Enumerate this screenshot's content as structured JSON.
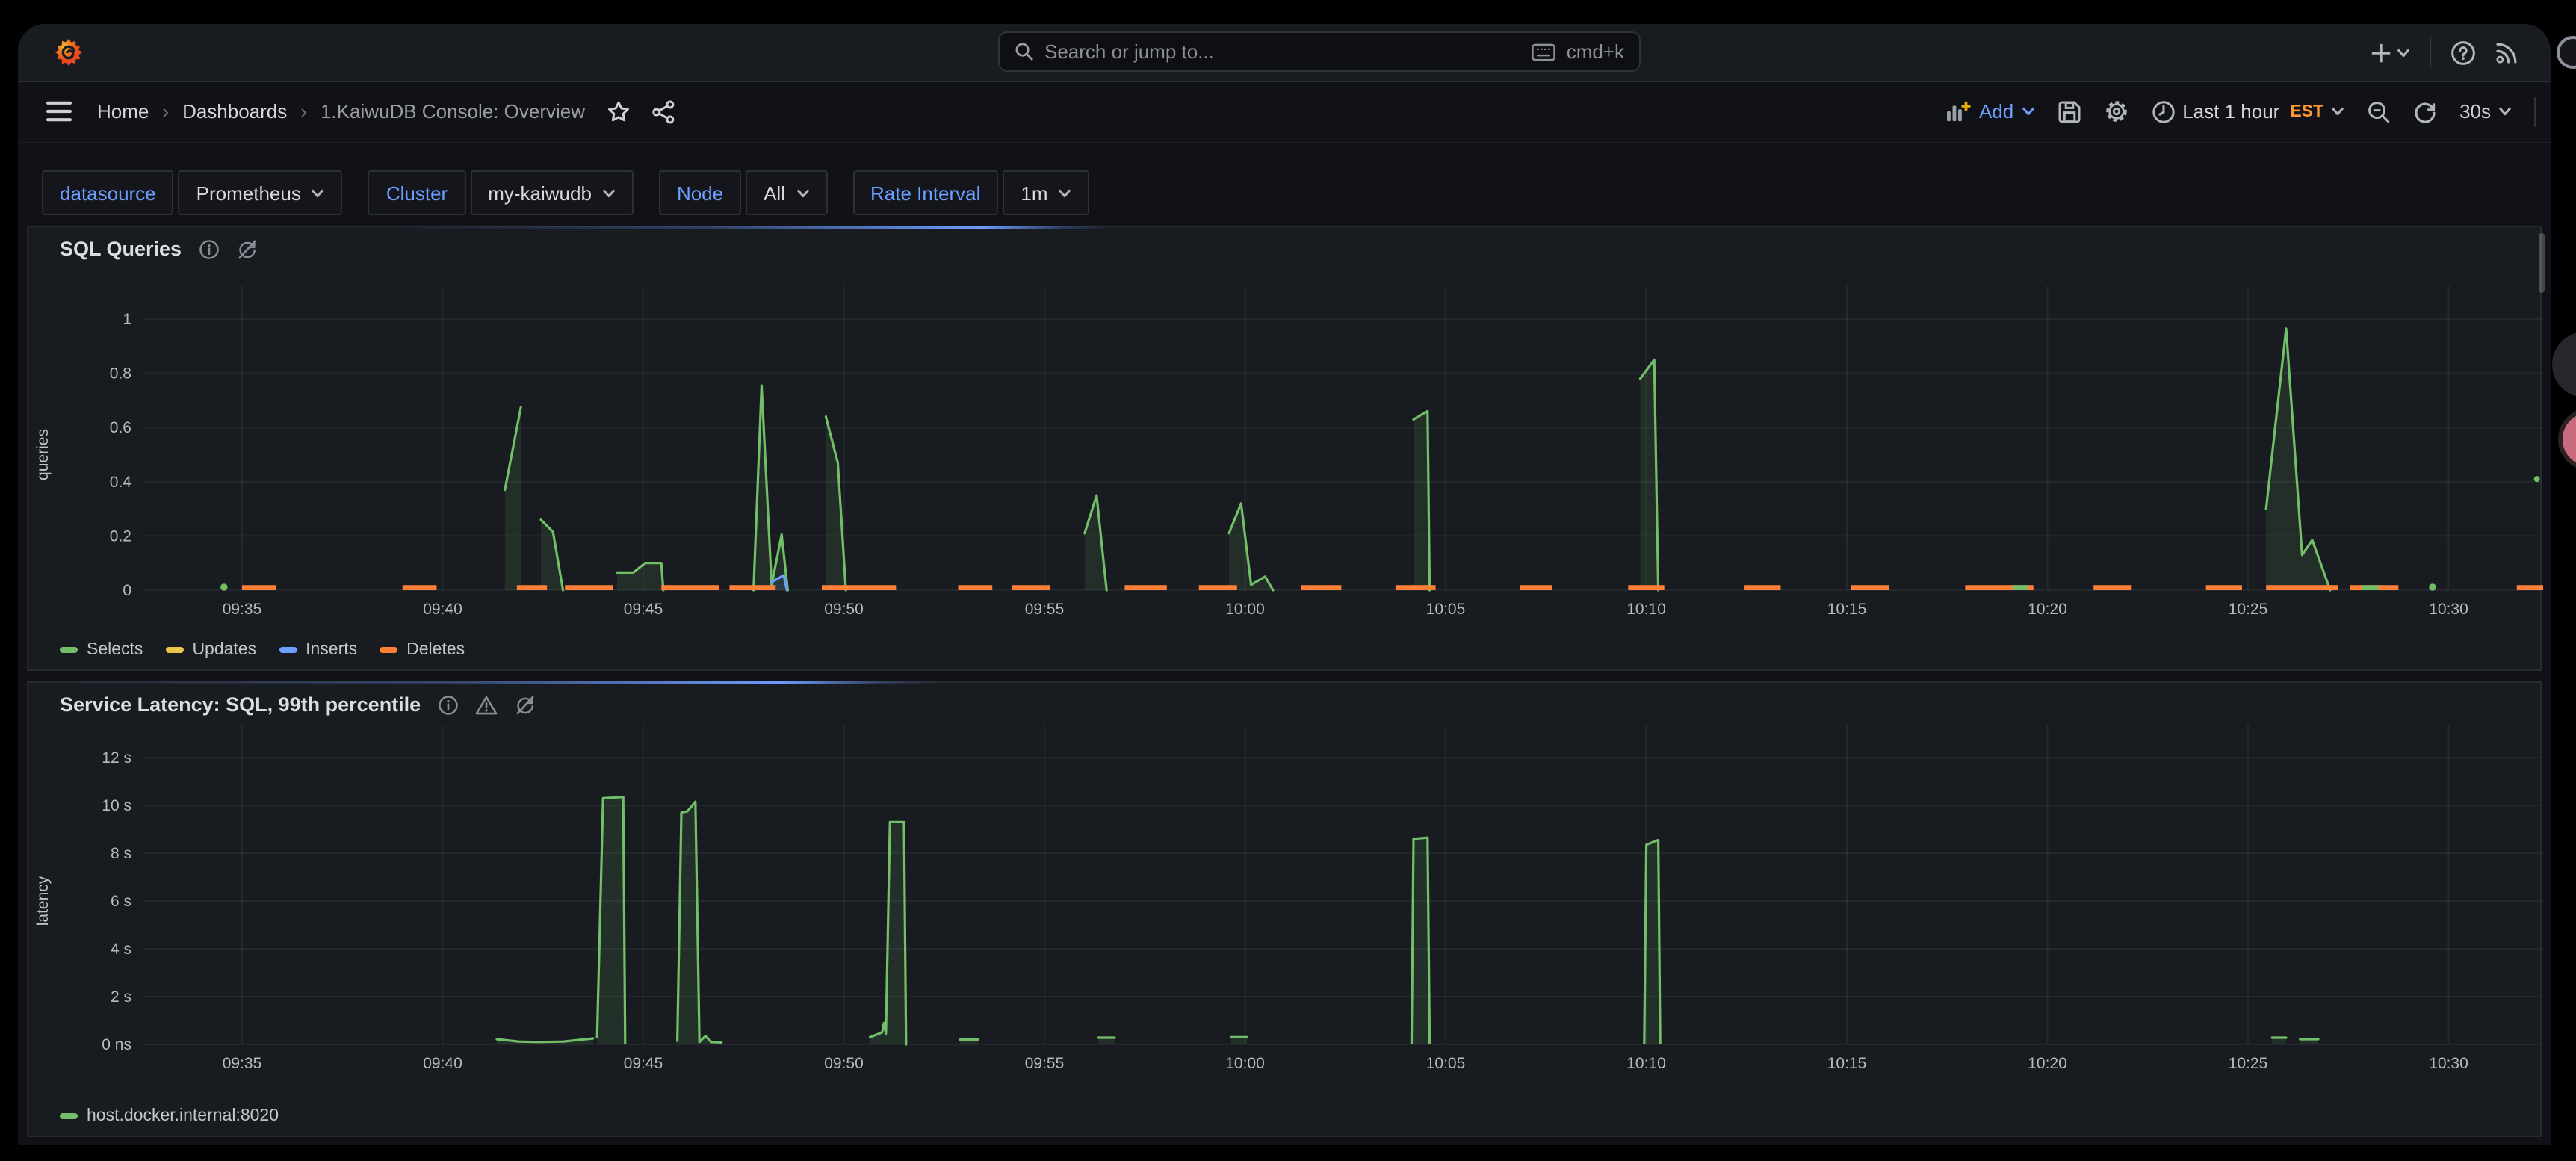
{
  "topbar": {
    "search": {
      "placeholder": "Search or jump to...",
      "shortcut": "cmd+k"
    }
  },
  "breadcrumb": {
    "items": [
      "Home",
      "Dashboards",
      "1.KaiwuDB Console: Overview"
    ]
  },
  "actions": {
    "add_label": "Add",
    "time_range": "Last 1 hour",
    "timezone": "EST",
    "refresh_interval": "30s"
  },
  "variables": [
    {
      "label": "datasource",
      "value": "Prometheus"
    },
    {
      "label": "Cluster",
      "value": "my-kaiwudb"
    },
    {
      "label": "Node",
      "value": "All"
    },
    {
      "label": "Rate Interval",
      "value": "1m"
    }
  ],
  "colors": {
    "accent_blue": "#6e9fff",
    "timezone_orange": "#ff9830",
    "series_green": "#73bf69",
    "series_yellow": "#e7c64a",
    "series_blue": "#6e9fff",
    "series_orange": "#ff8036",
    "panel_bg": "#181b1f",
    "page_bg": "#111217"
  },
  "icons": {
    "logo": "grafana-flame",
    "search": "magnifier",
    "shortcut": "keyboard",
    "new": "plus-chevron",
    "help": "question-circle",
    "news": "rss",
    "menu": "hamburger",
    "favorite": "star-outline",
    "share": "share-nodes",
    "add_panel": "chart-plus",
    "save": "floppy",
    "settings": "gear",
    "time": "clock",
    "zoom_out": "magnifier-minus",
    "refresh": "sync-arrows",
    "panel_info": "info-circle",
    "panel_warning": "warning-triangle",
    "panel_no_refresh": "sync-slash"
  },
  "chart_data": [
    {
      "type": "line",
      "title": "SQL Queries",
      "ylabel": "queries",
      "ylim": [
        0,
        1
      ],
      "grid": true,
      "legend_position": "bottom",
      "y_tick_values": [
        0,
        0.2,
        0.4,
        0.6,
        0.8,
        1
      ],
      "y_tick_labels": [
        "0",
        "0.2",
        "0.4",
        "0.6",
        "0.8",
        "1"
      ],
      "x_tick_minutes": [
        0,
        5,
        10,
        15,
        20,
        25,
        30,
        35,
        40,
        45,
        50,
        55
      ],
      "x_tick_labels": [
        "09:35",
        "09:40",
        "09:45",
        "09:50",
        "09:55",
        "10:00",
        "10:05",
        "10:10",
        "10:15",
        "10:20",
        "10:25",
        "10:30"
      ],
      "x_axis_start": "09:35",
      "series": [
        {
          "name": "Selects",
          "color": "#73bf69",
          "fill": "rgba(115,191,105,0.12)",
          "segments": [
            [
              [
                6.55,
                0.37
              ],
              [
                6.95,
                0.675
              ]
            ],
            [
              [
                7.45,
                0.26
              ],
              [
                7.75,
                0.215
              ],
              [
                8.0,
                0.0
              ]
            ],
            [
              [
                9.35,
                0.065
              ],
              [
                9.75,
                0.065
              ],
              [
                10.05,
                0.1
              ],
              [
                10.45,
                0.1
              ],
              [
                10.5,
                0.0
              ]
            ],
            [
              [
                12.75,
                0.0
              ],
              [
                12.95,
                0.755
              ],
              [
                13.2,
                0.02
              ],
              [
                13.45,
                0.205
              ],
              [
                13.6,
                0.0
              ]
            ],
            [
              [
                14.55,
                0.64
              ],
              [
                14.85,
                0.47
              ],
              [
                15.05,
                0.0
              ]
            ],
            [
              [
                21.0,
                0.21
              ],
              [
                21.3,
                0.35
              ],
              [
                21.55,
                0.0
              ]
            ],
            [
              [
                24.6,
                0.21
              ],
              [
                24.9,
                0.32
              ],
              [
                25.15,
                0.02
              ],
              [
                25.5,
                0.05
              ],
              [
                25.7,
                0.0
              ]
            ],
            [
              [
                29.2,
                0.63
              ],
              [
                29.55,
                0.66
              ],
              [
                29.6,
                0.0
              ]
            ],
            [
              [
                34.85,
                0.78
              ],
              [
                35.2,
                0.85
              ],
              [
                35.3,
                0.0
              ]
            ],
            [
              [
                50.45,
                0.3
              ],
              [
                50.95,
                0.965
              ],
              [
                51.35,
                0.13
              ],
              [
                51.6,
                0.185
              ],
              [
                52.05,
                0.0
              ]
            ]
          ],
          "zero_segments": [
            [
              44.15,
              44.5
            ],
            [
              52.85,
              53.25
            ]
          ],
          "dots": [
            [
              -0.45,
              0
            ],
            [
              54.6,
              0
            ],
            [
              57.2,
              0.41
            ]
          ]
        },
        {
          "name": "Updates",
          "color": "#e7c64a",
          "segments": []
        },
        {
          "name": "Inserts",
          "color": "#6e9fff",
          "fill": "rgba(110,159,255,0.12)",
          "segments": [
            [
              [
                13.2,
                0.03
              ],
              [
                13.5,
                0.055
              ],
              [
                13.58,
                0.0
              ]
            ]
          ]
        },
        {
          "name": "Deletes",
          "color": "#ff8036",
          "zero_segments": [
            [
              0.0,
              0.85
            ],
            [
              4.0,
              4.85
            ],
            [
              6.85,
              7.6
            ],
            [
              8.05,
              9.25
            ],
            [
              10.45,
              11.9
            ],
            [
              12.15,
              13.3
            ],
            [
              14.45,
              16.3
            ],
            [
              17.85,
              18.7
            ],
            [
              19.2,
              20.15
            ],
            [
              22.0,
              23.05
            ],
            [
              23.85,
              24.8
            ],
            [
              26.4,
              27.4
            ],
            [
              28.75,
              29.75
            ],
            [
              31.85,
              32.65
            ],
            [
              34.55,
              35.45
            ],
            [
              37.45,
              38.35
            ],
            [
              40.1,
              41.05
            ],
            [
              42.95,
              44.65
            ],
            [
              46.15,
              47.1
            ],
            [
              48.95,
              49.85
            ],
            [
              50.45,
              52.25
            ],
            [
              52.55,
              53.75
            ],
            [
              56.7,
              57.4
            ]
          ]
        }
      ]
    },
    {
      "type": "line",
      "title": "Service Latency: SQL, 99th percentile",
      "ylabel": "latency",
      "ylim": [
        0,
        12
      ],
      "grid": true,
      "legend_position": "bottom",
      "y_tick_values": [
        0,
        2,
        4,
        6,
        8,
        10,
        12
      ],
      "y_tick_labels": [
        "0 ns",
        "2 s",
        "4 s",
        "6 s",
        "8 s",
        "10 s",
        "12 s"
      ],
      "x_tick_minutes": [
        0,
        5,
        10,
        15,
        20,
        25,
        30,
        35,
        40,
        45,
        50,
        55
      ],
      "x_tick_labels": [
        "09:35",
        "09:40",
        "09:45",
        "09:50",
        "09:55",
        "10:00",
        "10:05",
        "10:10",
        "10:15",
        "10:20",
        "10:25",
        "10:30"
      ],
      "x_axis_start": "09:35",
      "series": [
        {
          "name": "host.docker.internal:8020",
          "color": "#73bf69",
          "fill": "rgba(115,191,105,0.13)",
          "segments": [
            [
              [
                6.35,
                0.22
              ],
              [
                6.9,
                0.12
              ],
              [
                7.4,
                0.1
              ],
              [
                8.0,
                0.12
              ],
              [
                8.75,
                0.25
              ]
            ],
            [
              [
                8.85,
                0.3
              ],
              [
                9.0,
                10.3
              ],
              [
                9.5,
                10.35
              ],
              [
                9.55,
                0.05
              ]
            ],
            [
              [
                10.85,
                0.15
              ],
              [
                10.95,
                9.7
              ],
              [
                11.1,
                9.75
              ],
              [
                11.3,
                10.15
              ],
              [
                11.4,
                0.1
              ],
              [
                11.55,
                0.35
              ],
              [
                11.7,
                0.1
              ],
              [
                11.95,
                0.08
              ]
            ],
            [
              [
                15.65,
                0.3
              ],
              [
                15.95,
                0.5
              ],
              [
                16.0,
                0.9
              ],
              [
                16.05,
                0.45
              ],
              [
                16.15,
                9.3
              ],
              [
                16.5,
                9.3
              ],
              [
                16.55,
                0.0
              ]
            ],
            [
              [
                17.9,
                0.2
              ],
              [
                18.35,
                0.2
              ]
            ],
            [
              [
                21.35,
                0.28
              ],
              [
                21.75,
                0.28
              ]
            ],
            [
              [
                24.65,
                0.3
              ],
              [
                25.05,
                0.3
              ]
            ],
            [
              [
                29.15,
                0.05
              ],
              [
                29.2,
                8.6
              ],
              [
                29.55,
                8.65
              ],
              [
                29.6,
                0.05
              ]
            ],
            [
              [
                34.95,
                0.05
              ],
              [
                35.0,
                8.35
              ],
              [
                35.3,
                8.55
              ],
              [
                35.35,
                0.05
              ]
            ],
            [
              [
                50.6,
                0.28
              ],
              [
                50.95,
                0.28
              ]
            ],
            [
              [
                51.3,
                0.22
              ],
              [
                51.75,
                0.22
              ]
            ]
          ]
        }
      ]
    }
  ]
}
